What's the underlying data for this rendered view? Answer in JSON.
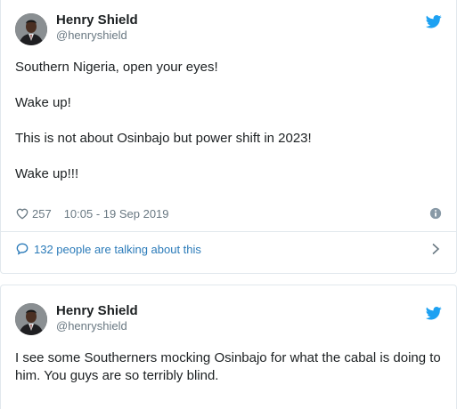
{
  "tweets": [
    {
      "author_name": "Henry Shield",
      "author_handle": "@henryshield",
      "paragraphs": [
        "Southern Nigeria, open your eyes!",
        "Wake up!",
        "This is not about Osinbajo but power shift in 2023!",
        "Wake up!!!"
      ],
      "likes": "257",
      "timestamp": "10:05 - 19 Sep 2019",
      "conversation": "132 people are talking about this"
    },
    {
      "author_name": "Henry Shield",
      "author_handle": "@henryshield",
      "text": "I see some Southerners mocking Osinbajo for what the cabal is doing to him. You guys are so terribly blind."
    }
  ],
  "icons": {
    "brand": "twitter-bird-icon",
    "like": "heart-icon",
    "info": "info-icon",
    "reply": "speech-bubble-icon",
    "more": "chevron-right-icon"
  },
  "colors": {
    "twitter_blue": "#1da1f2",
    "link_blue": "#2b7bb9",
    "meta_gray": "#697882",
    "text": "#1c2022",
    "border": "#e1e8ed"
  }
}
